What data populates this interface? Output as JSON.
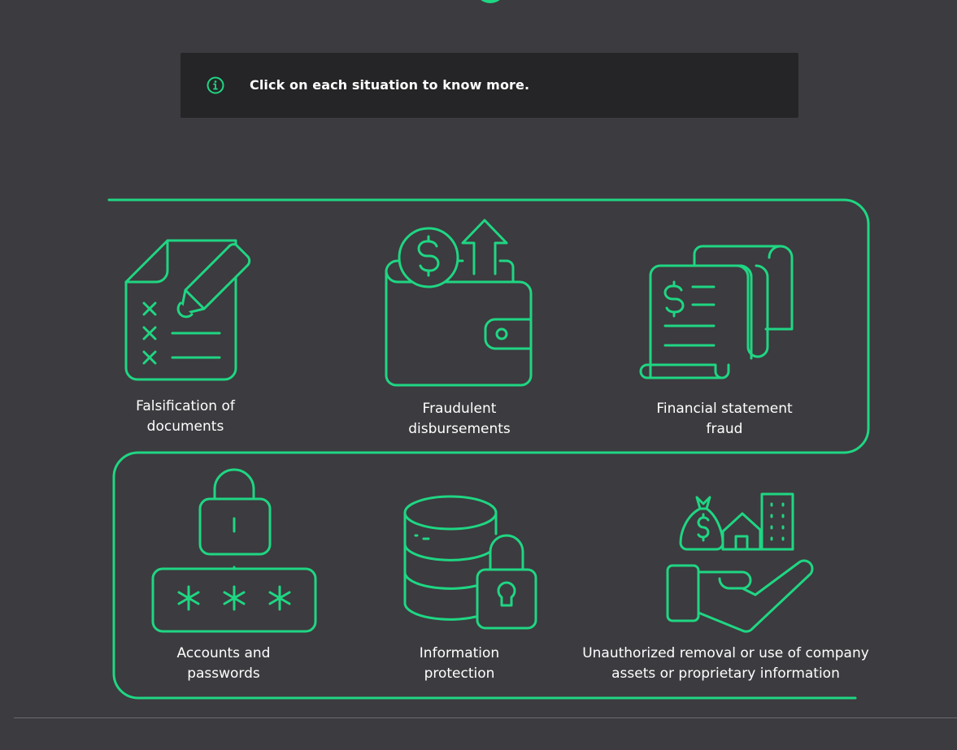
{
  "info": {
    "icon": "info-icon",
    "text": "Click on each situation to know more."
  },
  "colors": {
    "accent": "#1fd683",
    "background": "#3c3b3f",
    "info_bar": "#252527",
    "text": "#ffffff"
  },
  "situations": [
    {
      "icon": "document-pen-icon",
      "line1": "Falsification of",
      "line2": "documents"
    },
    {
      "icon": "wallet-dollar-icon",
      "line1": "Fraudulent",
      "line2": "disbursements"
    },
    {
      "icon": "financial-receipt-icon",
      "line1": "Financial statement",
      "line2": "fraud"
    },
    {
      "icon": "padlock-password-icon",
      "line1": "Accounts and",
      "line2": "passwords"
    },
    {
      "icon": "database-lock-icon",
      "line1": "Information",
      "line2": "protection"
    },
    {
      "icon": "hand-assets-icon",
      "line1": "Unauthorized removal or use of company",
      "line2": "assets or proprietary information"
    }
  ]
}
